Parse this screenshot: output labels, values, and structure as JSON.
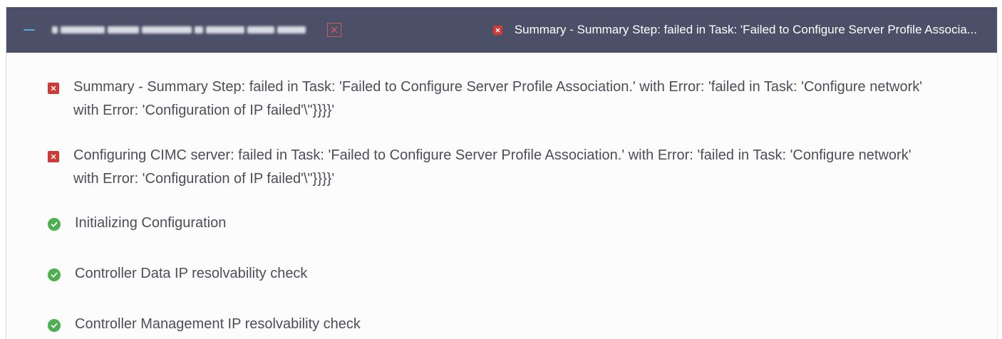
{
  "header": {
    "summary_status": "failed",
    "summary_text": "Summary - Summary Step: failed in Task: 'Failed to Configure Server Profile Associa..."
  },
  "icons": {
    "collapse": "minus-icon",
    "close": "close-x-icon",
    "failed": "error-x-icon",
    "success": "check-circle-icon"
  },
  "colors": {
    "header_bg": "#4b5068",
    "accent": "#5aa6d6",
    "failed": "#cf3a35",
    "success": "#4caf50"
  },
  "steps": [
    {
      "status": "failed",
      "text": "Summary - Summary Step: failed in Task: 'Failed to Configure Server Profile Association.' with Error: 'failed in Task: 'Configure network' with Error: 'Configuration of IP failed'\\\"}}}}'"
    },
    {
      "status": "failed",
      "text": "Configuring CIMC server: failed in Task: 'Failed to Configure Server Profile Association.' with Error: 'failed in Task: 'Configure network' with Error: 'Configuration of IP failed'\\\"}}}}'"
    },
    {
      "status": "success",
      "text": "Initializing Configuration"
    },
    {
      "status": "success",
      "text": "Controller Data IP resolvability check"
    },
    {
      "status": "success",
      "text": "Controller Management IP resolvability check"
    }
  ]
}
